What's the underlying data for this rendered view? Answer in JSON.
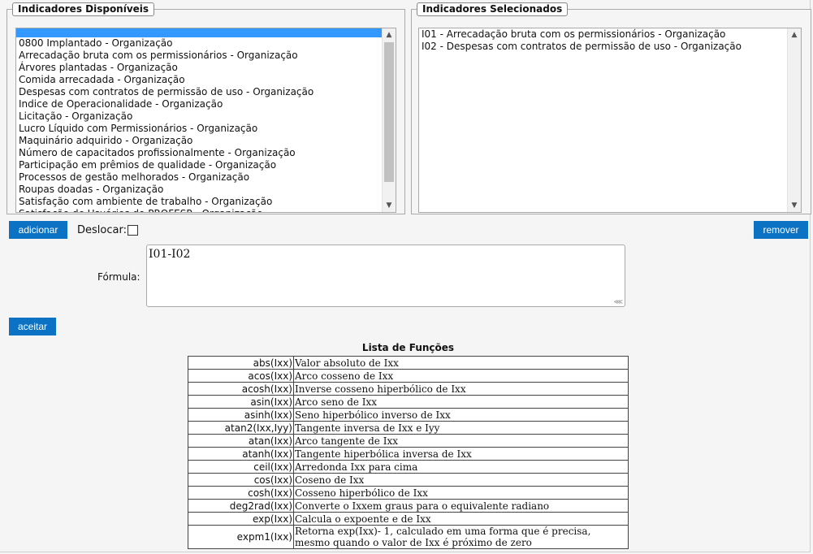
{
  "available": {
    "legend": "Indicadores Disponíveis",
    "items": [
      "0800 Implantado - Organização",
      "Arrecadação bruta com os permissionários - Organização",
      "Árvores plantadas - Organização",
      "Comida arrecadada - Organização",
      "Despesas com contratos de permissão de uso - Organização",
      "Indice de Operacionalidade - Organização",
      "Licitação - Organização",
      "Lucro Líquido com Permissionários - Organização",
      "Maquinário adquirido - Organização",
      "Número de capacitados profissionalmente - Organização",
      "Participação em prêmios de qualidade - Organização",
      "Processos de gestão melhorados - Organização",
      "Roupas doadas - Organização",
      "Satisfação com ambiente de trabalho - Organização",
      "Satisfação de Usuários do PROFESP - Organização"
    ]
  },
  "selected": {
    "legend": "Indicadores Selecionados",
    "items": [
      "I01 - Arrecadação bruta com os permissionários - Organização",
      "I02 - Despesas com contratos de permissão de uso - Organização"
    ]
  },
  "controls": {
    "add_label": "adicionar",
    "remove_label": "remover",
    "shift_label": "Deslocar:",
    "shift_checked": false,
    "formula_label": "Fórmula:",
    "formula_value": "I01-I02",
    "accept_label": "aceitar"
  },
  "functions": {
    "title": "Lista de Funções",
    "rows": [
      {
        "fn": "abs(Ixx)",
        "desc": "Valor absoluto de Ixx"
      },
      {
        "fn": "acos(Ixx)",
        "desc": "Arco cosseno de Ixx"
      },
      {
        "fn": "acosh(Ixx)",
        "desc": "Inverse cosseno hiperbólico de Ixx"
      },
      {
        "fn": "asin(Ixx)",
        "desc": "Arco seno de Ixx"
      },
      {
        "fn": "asinh(Ixx)",
        "desc": "Seno hiperbólico inverso de Ixx"
      },
      {
        "fn": "atan2(Ixx,Iyy)",
        "desc": "Tangente inversa de Ixx e Iyy"
      },
      {
        "fn": "atan(Ixx)",
        "desc": "Arco tangente de Ixx"
      },
      {
        "fn": "atanh(Ixx)",
        "desc": "Tangente hiperbólica inversa de Ixx"
      },
      {
        "fn": "ceil(Ixx)",
        "desc": "Arredonda Ixx para cima"
      },
      {
        "fn": "cos(Ixx)",
        "desc": "Coseno de Ixx"
      },
      {
        "fn": "cosh(Ixx)",
        "desc": "Cosseno hiperbólico de Ixx"
      },
      {
        "fn": "deg2rad(Ixx)",
        "desc": "Converte o Ixxem graus para o equivalente radiano"
      },
      {
        "fn": "exp(Ixx)",
        "desc": "Calcula o expoente e de Ixx"
      },
      {
        "fn": "expm1(Ixx)",
        "desc": "Retorna exp(Ixx)- 1, calculado em uma forma que é precisa, mesmo quando o valor de Ixx é próximo de zero"
      }
    ]
  }
}
